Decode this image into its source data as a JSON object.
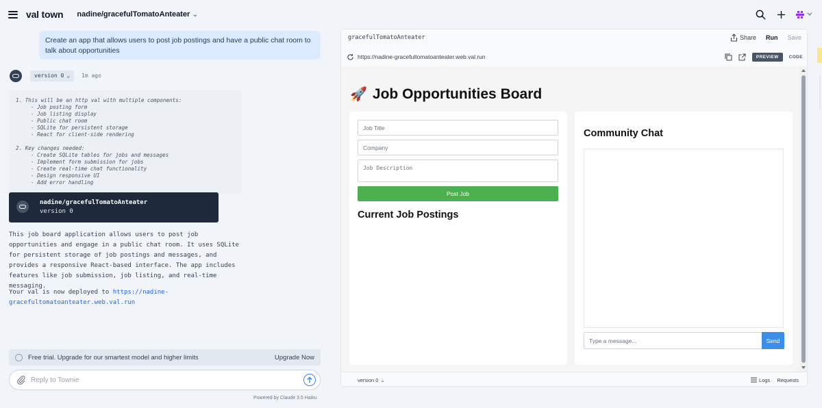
{
  "topbar": {
    "brand": "val town",
    "project": "nadine/gracefulTomatoAnteater",
    "icons": [
      "menu-icon",
      "chevron-down-icon",
      "search-icon",
      "plus-icon",
      "user-avatar-icon"
    ]
  },
  "chat": {
    "prompt": "Create an app that allows users to post job postings and have a public chat room to talk about opportunities",
    "version_label": "version 0",
    "time_ago": "1m ago",
    "plan": [
      {
        "num": "1. This will be an http val with multiple components:",
        "items": [
          "- Job posting form",
          "- Job listing display",
          "- Public chat room",
          "- SQLite for persistent storage",
          "- React for client-side rendering"
        ]
      },
      {
        "num": "2. Key changes needed:",
        "items": [
          "- Create SQLite tables for jobs and messages",
          "- Implement form submission for jobs",
          "- Create real-time chat functionality",
          "- Design responsive UI",
          "- Add error handling"
        ]
      }
    ],
    "version_card": {
      "title": "nadine/gracefulTomatoAnteater",
      "subtitle": "version 0"
    },
    "summary": "This job board application allows users to post job opportunities and engage in a public chat room. It uses SQLite for persistent storage of job postings and messages, and provides a responsive React-based interface. The app includes features like job submission, job listing, and real-time messaging.",
    "deployed_prefix": "Your val is now deployed to",
    "deployed_link": "https://nadine-gracefultomatoanteater.web.val.run",
    "trial_text": "Free trial. Upgrade for our smartest model and higher limits",
    "upgrade_label": "Upgrade Now",
    "reply_placeholder": "Reply to Townie",
    "powered_by": "Powered by Claude 3.5 Haiku"
  },
  "preview": {
    "filename": "gracefulTomatoAnteater",
    "share_label": "Share",
    "run_label": "Run",
    "save_label": "Save",
    "url": "https://nadine-gracefultomatoanteater.web.val.run",
    "preview_label": "PREVIEW",
    "code_label": "CODE",
    "app": {
      "title": "Job Opportunities Board",
      "job_title_placeholder": "Job Title",
      "company_placeholder": "Company",
      "description_placeholder": "Job Description",
      "post_button": "Post Job",
      "postings_heading": "Current Job Postings",
      "chat_heading": "Community Chat",
      "message_placeholder": "Type a message...",
      "send_button": "Send"
    },
    "footer": {
      "version_label": "version 0",
      "logs_label": "Logs",
      "requests_label": "Requests"
    }
  },
  "colors": {
    "accent_blue": "#3b8fe8",
    "post_green": "#4caf50",
    "dark_card": "#1e293b",
    "prompt_bubble": "#dbeafe"
  }
}
